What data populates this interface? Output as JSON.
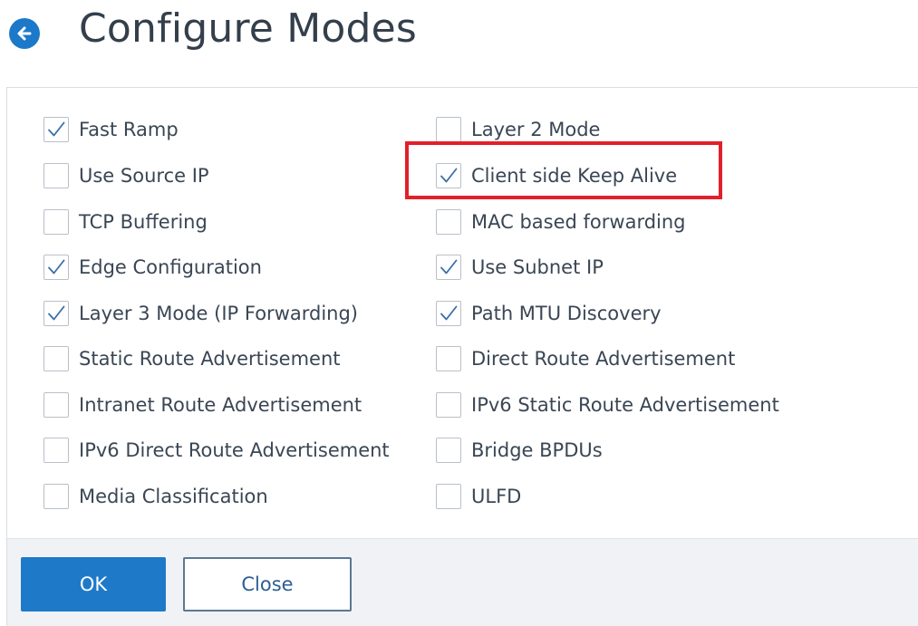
{
  "header": {
    "back_icon": "arrow-left-circle-icon",
    "title": "Configure Modes"
  },
  "options": {
    "left": [
      {
        "label": "Fast Ramp",
        "checked": true
      },
      {
        "label": "Use Source IP",
        "checked": false
      },
      {
        "label": "TCP Buffering",
        "checked": false
      },
      {
        "label": "Edge Configuration",
        "checked": true
      },
      {
        "label": "Layer 3 Mode (IP Forwarding)",
        "checked": true
      },
      {
        "label": "Static Route Advertisement",
        "checked": false
      },
      {
        "label": "Intranet Route Advertisement",
        "checked": false
      },
      {
        "label": "IPv6 Direct Route Advertisement",
        "checked": false
      },
      {
        "label": "Media Classification",
        "checked": false
      }
    ],
    "right": [
      {
        "label": "Layer 2 Mode",
        "checked": false
      },
      {
        "label": "Client side Keep Alive",
        "checked": true
      },
      {
        "label": "MAC based forwarding",
        "checked": false
      },
      {
        "label": "Use Subnet IP",
        "checked": true
      },
      {
        "label": "Path MTU Discovery",
        "checked": true
      },
      {
        "label": "Direct Route Advertisement",
        "checked": false
      },
      {
        "label": "IPv6 Static Route Advertisement",
        "checked": false
      },
      {
        "label": "Bridge BPDUs",
        "checked": false
      },
      {
        "label": "ULFD",
        "checked": false
      }
    ]
  },
  "footer": {
    "ok_label": "OK",
    "close_label": "Close"
  },
  "colors": {
    "accent": "#1e7ac9",
    "highlight": "#e2202a",
    "check": "#3a6fa8"
  }
}
